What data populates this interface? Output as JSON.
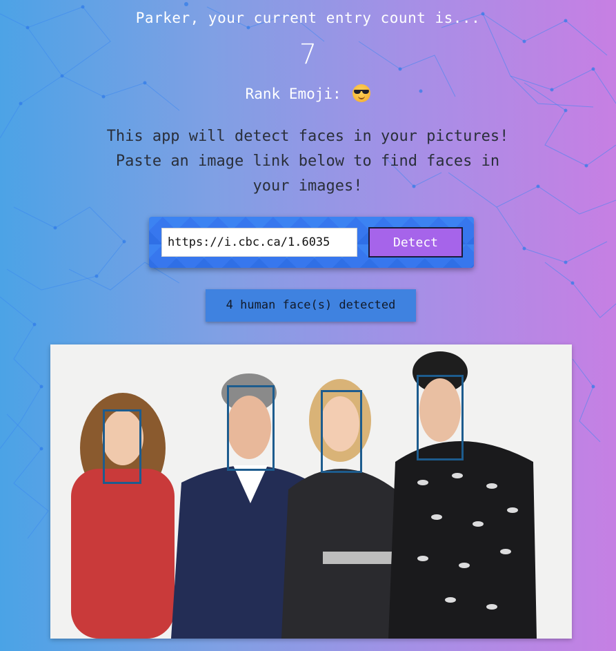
{
  "header": {
    "greeting": "Parker, your current entry count is...",
    "entry_count": "7",
    "rank_label": "Rank Emoji:",
    "rank_emoji_icon": "smiling-face-with-sunglasses-icon"
  },
  "description": {
    "line1": "This app will detect faces in your pictures!",
    "line2": "Paste an image link below to find faces in",
    "line3": "your images!"
  },
  "form": {
    "url_value": "https://i.cbc.ca/1.6035",
    "detect_label": "Detect"
  },
  "result": {
    "status_text": "4 human face(s) detected",
    "face_count": 4
  },
  "colors": {
    "background_start": "#4aa3e6",
    "background_end": "#c77fe3",
    "detect_button": "#a664ea",
    "status_badge": "#3f82e0",
    "face_box": "#1d5c8e"
  }
}
